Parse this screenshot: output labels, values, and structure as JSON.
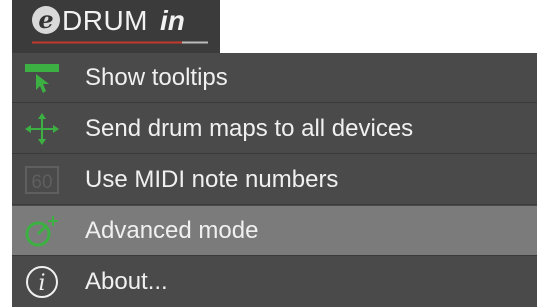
{
  "logo": {
    "prefix": "e",
    "brand": "DRUM",
    "suffix": "in"
  },
  "menu": {
    "items": [
      {
        "label": "Show tooltips",
        "icon": "tooltip-cursor-icon"
      },
      {
        "label": "Send drum maps to all devices",
        "icon": "broadcast-arrows-icon"
      },
      {
        "label": "Use MIDI note numbers",
        "icon": "note-number-icon",
        "icon_text": "60"
      },
      {
        "label": "Advanced mode",
        "icon": "advanced-mode-icon",
        "highlighted": true
      },
      {
        "label": "About...",
        "icon": "info-icon",
        "icon_text": "i"
      }
    ]
  },
  "colors": {
    "menu_bg": "#4a4a4a",
    "highlight_bg": "#7b7b7b",
    "icon_green": "#3cb043",
    "text": "#f0f0f0"
  }
}
